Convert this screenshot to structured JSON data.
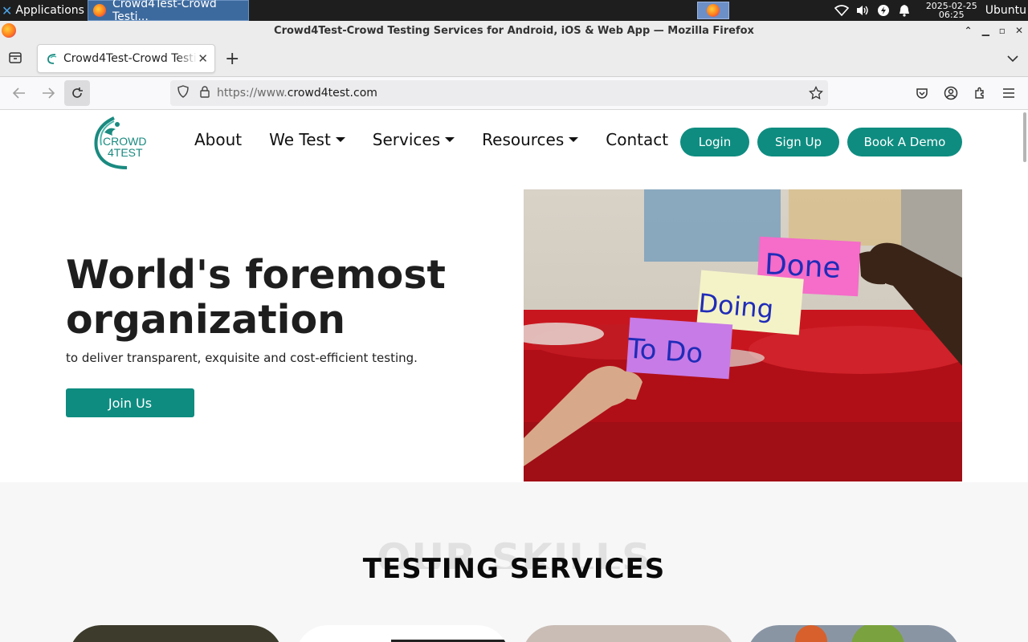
{
  "os": {
    "apps_label": "Applications",
    "taskbar_window": "Crowd4Test-Crowd Testi...",
    "clock_date": "2025-02-25",
    "clock_time": "06:25",
    "user": "Ubuntu"
  },
  "browser": {
    "window_title": "Crowd4Test-Crowd Testing Services for Android, iOS & Web App — Mozilla Firefox",
    "tab_title": "Crowd4Test-Crowd Testing Services for Android, iOS & Web App",
    "url_prefix": "https://www.",
    "url_domain": "crowd4test.com"
  },
  "site": {
    "logo_line1": "CROWD",
    "logo_line2": "4TEST",
    "nav": [
      {
        "label": "About"
      },
      {
        "label": "We Test"
      },
      {
        "label": "Services"
      },
      {
        "label": "Resources"
      },
      {
        "label": "Contact"
      }
    ],
    "buttons": {
      "login": "Login",
      "signup": "Sign Up",
      "demo": "Book A Demo"
    },
    "hero": {
      "title": "World's foremost organization",
      "subtitle": "to deliver transparent, exquisite and cost-efficient testing.",
      "cta": "Join Us",
      "notes": [
        "Done",
        "Doing",
        "To Do"
      ]
    },
    "skills": {
      "background_text": "OUR SKILLS",
      "title": "TESTING SERVICES"
    }
  },
  "colors": {
    "brand": "#0e8c80",
    "note_done": "#f56cc9",
    "note_doing": "#f4f3c8",
    "note_todo": "#c77be6"
  }
}
